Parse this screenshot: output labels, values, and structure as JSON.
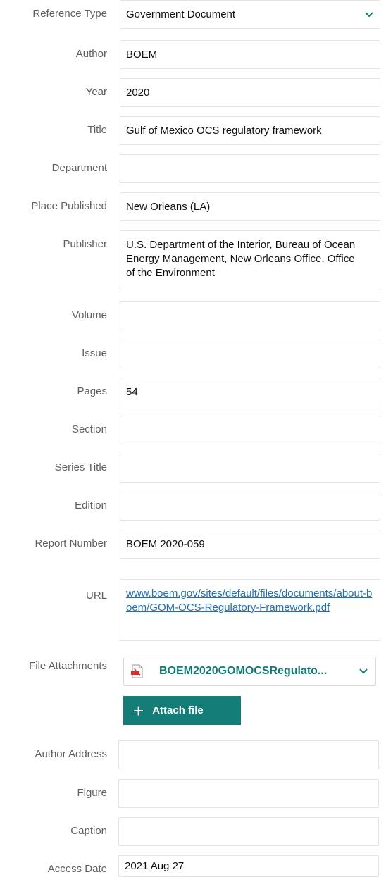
{
  "colors": {
    "accent": "#157d77",
    "link": "#1a6fc9",
    "label": "#5f5f5f",
    "border": "#e3e3e3"
  },
  "fields": {
    "reference_type": {
      "label": "Reference Type",
      "value": "Government Document",
      "icon": "chevron-down-icon"
    },
    "author": {
      "label": "Author",
      "value": "BOEM"
    },
    "year": {
      "label": "Year",
      "value": "2020"
    },
    "title": {
      "label": "Title",
      "value": "Gulf of Mexico OCS regulatory framework"
    },
    "department": {
      "label": "Department",
      "value": ""
    },
    "place_published": {
      "label": "Place Published",
      "value": "New Orleans (LA)"
    },
    "publisher": {
      "label": "Publisher",
      "value": "U.S. Department of the Interior, Bureau of Ocean Energy Management, New Orleans Office, Office of the Environment"
    },
    "volume": {
      "label": "Volume",
      "value": ""
    },
    "issue": {
      "label": "Issue",
      "value": ""
    },
    "pages": {
      "label": "Pages",
      "value": "54"
    },
    "section": {
      "label": "Section",
      "value": ""
    },
    "series_title": {
      "label": "Series Title",
      "value": ""
    },
    "edition": {
      "label": "Edition",
      "value": ""
    },
    "report_number": {
      "label": "Report Number",
      "value": "BOEM 2020-059"
    },
    "url": {
      "label": "URL",
      "value": "www.boem.gov/sites/default/files/documents/about-boem/GOM-OCS-Regulatory-Framework.pdf"
    },
    "file_attachments": {
      "label": "File Attachments",
      "file_name": "BOEM2020GOMOCSRegulato...",
      "file_icon": "pdf-file-icon",
      "attach_label": "Attach file",
      "attach_icon": "plus-icon"
    },
    "author_address": {
      "label": "Author Address",
      "value": ""
    },
    "figure": {
      "label": "Figure",
      "value": ""
    },
    "caption": {
      "label": "Caption",
      "value": ""
    },
    "access_date": {
      "label": "Access Date",
      "value": "2021 Aug 27"
    }
  }
}
